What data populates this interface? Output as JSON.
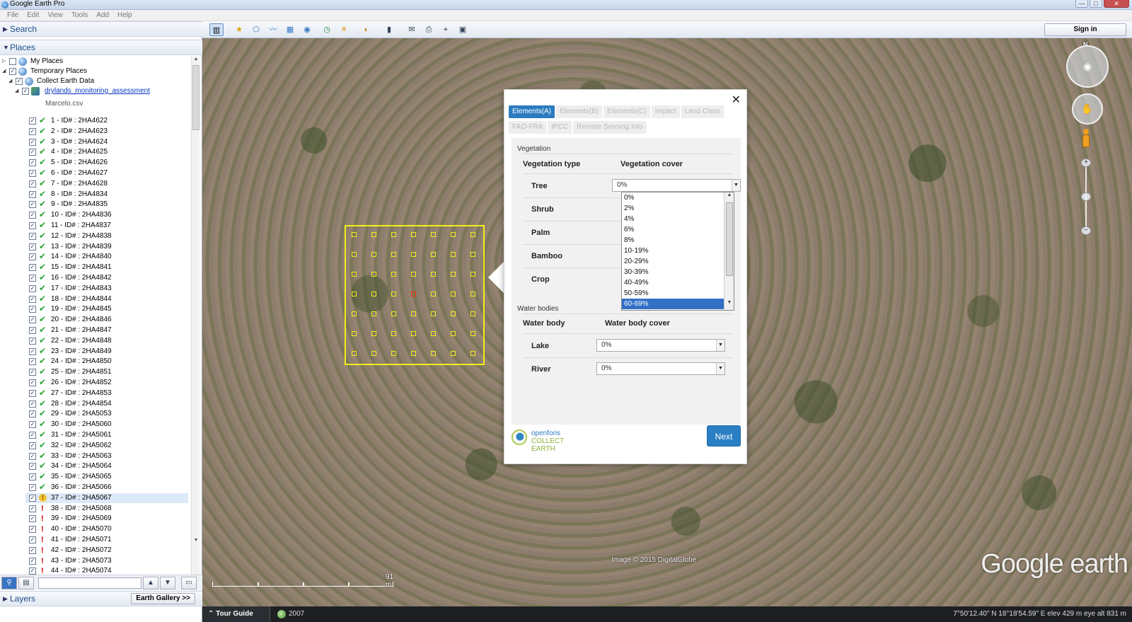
{
  "window": {
    "title": "Google Earth Pro"
  },
  "menu": [
    "File",
    "Edit",
    "View",
    "Tools",
    "Add",
    "Help"
  ],
  "left_panel": {
    "search_label": "Search",
    "places_label": "Places",
    "layers_label": "Layers",
    "earth_gallery_label": "Earth Gallery >>",
    "tree": {
      "my_places": "My Places",
      "temporary_places": "Temporary Places",
      "collect_earth_data": "Collect Earth Data",
      "survey_link": "drylands_monitoring_assessment",
      "csv_file": "Marcelo.csv",
      "plots": [
        {
          "label": "1 - ID# : 2HA4622",
          "status": "ok"
        },
        {
          "label": "2 - ID# : 2HA4623",
          "status": "ok"
        },
        {
          "label": "3 - ID# : 2HA4624",
          "status": "ok"
        },
        {
          "label": "4 - ID# : 2HA4625",
          "status": "ok"
        },
        {
          "label": "5 - ID# : 2HA4626",
          "status": "ok"
        },
        {
          "label": "6 - ID# : 2HA4627",
          "status": "ok"
        },
        {
          "label": "7 - ID# : 2HA4628",
          "status": "ok"
        },
        {
          "label": "8 - ID# : 2HA4834",
          "status": "ok"
        },
        {
          "label": "9 - ID# : 2HA4835",
          "status": "ok"
        },
        {
          "label": "10 - ID# : 2HA4836",
          "status": "ok"
        },
        {
          "label": "11 - ID# : 2HA4837",
          "status": "ok"
        },
        {
          "label": "12 - ID# : 2HA4838",
          "status": "ok"
        },
        {
          "label": "13 - ID# : 2HA4839",
          "status": "ok"
        },
        {
          "label": "14 - ID# : 2HA4840",
          "status": "ok"
        },
        {
          "label": "15 - ID# : 2HA4841",
          "status": "ok"
        },
        {
          "label": "16 - ID# : 2HA4842",
          "status": "ok"
        },
        {
          "label": "17 - ID# : 2HA4843",
          "status": "ok"
        },
        {
          "label": "18 - ID# : 2HA4844",
          "status": "ok"
        },
        {
          "label": "19 - ID# : 2HA4845",
          "status": "ok"
        },
        {
          "label": "20 - ID# : 2HA4846",
          "status": "ok"
        },
        {
          "label": "21 - ID# : 2HA4847",
          "status": "ok"
        },
        {
          "label": "22 - ID# : 2HA4848",
          "status": "ok"
        },
        {
          "label": "23 - ID# : 2HA4849",
          "status": "ok"
        },
        {
          "label": "24 - ID# : 2HA4850",
          "status": "ok"
        },
        {
          "label": "25 - ID# : 2HA4851",
          "status": "ok"
        },
        {
          "label": "26 - ID# : 2HA4852",
          "status": "ok"
        },
        {
          "label": "27 - ID# : 2HA4853",
          "status": "ok"
        },
        {
          "label": "28 - ID# : 2HA4854",
          "status": "ok"
        },
        {
          "label": "29 - ID# : 2HA5053",
          "status": "ok"
        },
        {
          "label": "30 - ID# : 2HA5060",
          "status": "ok"
        },
        {
          "label": "31 - ID# : 2HA5061",
          "status": "ok"
        },
        {
          "label": "32 - ID# : 2HA5062",
          "status": "ok"
        },
        {
          "label": "33 - ID# : 2HA5063",
          "status": "ok"
        },
        {
          "label": "34 - ID# : 2HA5064",
          "status": "ok"
        },
        {
          "label": "35 - ID# : 2HA5065",
          "status": "ok"
        },
        {
          "label": "36 - ID# : 2HA5066",
          "status": "ok"
        },
        {
          "label": "37 - ID# : 2HA5067",
          "status": "warning",
          "selected": true
        },
        {
          "label": "38 - ID# : 2HA5068",
          "status": "error"
        },
        {
          "label": "39 - ID# : 2HA5069",
          "status": "error"
        },
        {
          "label": "40 - ID# : 2HA5070",
          "status": "error"
        },
        {
          "label": "41 - ID# : 2HA5071",
          "status": "error"
        },
        {
          "label": "42 - ID# : 2HA5072",
          "status": "error"
        },
        {
          "label": "43 - ID# : 2HA5073",
          "status": "error"
        },
        {
          "label": "44 - ID# : 2HA5074",
          "status": "error"
        }
      ]
    }
  },
  "toolbar": {
    "sign_in_label": "Sign in"
  },
  "map": {
    "attribution": "Image © 2015 DigitalGlobe",
    "brand": "Google earth",
    "scale_label": "91 m",
    "compass_north": "N"
  },
  "status_bar": {
    "tour_guide_label": "Tour Guide",
    "historical_year": "2007",
    "coordinates": "7°50'12.40\" N   18°18'54.59\" E   elev   429 m        eye alt   831 m"
  },
  "dialog": {
    "tabs": [
      {
        "label": "Elements(A)",
        "active": true
      },
      {
        "label": "Elements(B)",
        "active": false
      },
      {
        "label": "Elements(C)",
        "active": false
      },
      {
        "label": "Impact",
        "active": false
      },
      {
        "label": "Land Class",
        "active": false
      },
      {
        "label": "FAO-FRA",
        "active": false
      },
      {
        "label": "IPCC",
        "active": false
      },
      {
        "label": "Remote Sensing Info",
        "active": false
      }
    ],
    "vegetation": {
      "section_title": "Vegetation",
      "col_type": "Vegetation type",
      "col_cover": "Vegetation cover",
      "rows": [
        "Tree",
        "Shrub",
        "Palm",
        "Bamboo",
        "Crop"
      ],
      "tree_value": "0%"
    },
    "dropdown_options": [
      "0%",
      "2%",
      "4%",
      "6%",
      "8%",
      "10-19%",
      "20-29%",
      "30-39%",
      "40-49%",
      "50-59%",
      "60-69%"
    ],
    "dropdown_highlighted": "60-69%",
    "water": {
      "section_title": "Water bodies",
      "col_type": "Water body",
      "col_cover": "Water body cover",
      "rows": [
        {
          "label": "Lake",
          "value": "0%"
        },
        {
          "label": "River",
          "value": "0%"
        }
      ]
    },
    "logo_line1": "openforis",
    "logo_line2": "COLLECT EARTH",
    "next_label": "Next"
  }
}
